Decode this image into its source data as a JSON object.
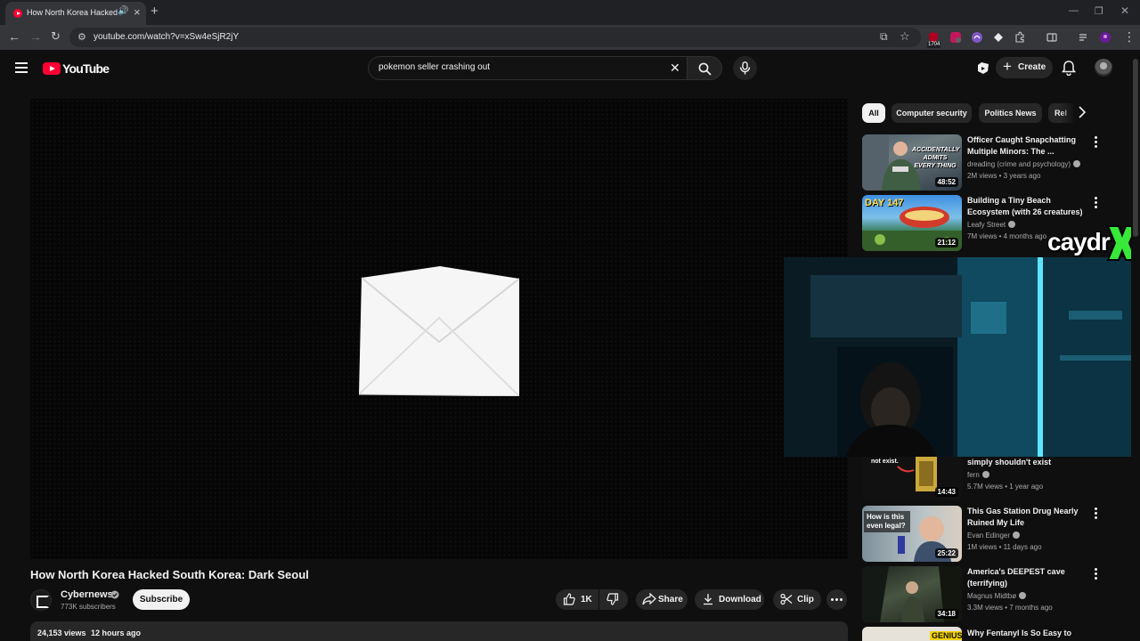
{
  "browser": {
    "tab_title": "How North Korea Hacked South Korea: Dark Seoul",
    "url": "youtube.com/watch?v=xSw4eSjR2jY",
    "extension_badge": "1704"
  },
  "header": {
    "logo_text": "YouTube",
    "search_value": "pokemon seller crashing out",
    "create_label": "Create"
  },
  "video": {
    "title": "How North Korea Hacked South Korea: Dark Seoul",
    "channel_name": "Cybernews",
    "subscribers": "773K subscribers",
    "subscribe_label": "Subscribe",
    "likes": "1K",
    "share_label": "Share",
    "download_label": "Download",
    "clip_label": "Clip",
    "views": "24,153 views",
    "age": "12 hours ago"
  },
  "chips": [
    "All",
    "Computer security",
    "Politics News",
    "Rel"
  ],
  "recommendations": [
    {
      "title": "Officer Caught Snapchatting Multiple Minors: The ...",
      "channel": "dreading (crime and psychology)",
      "meta": "2M views • 3 years ago",
      "duration": "48:52",
      "thumb_text": "ACCIDENTALLY ADMITS EVERY THING"
    },
    {
      "title": "Building a Tiny Beach Ecosystem (with 26 creatures)",
      "channel": "Leafy Street",
      "meta": "7M views • 4 months ago",
      "duration": "21:12",
      "thumb_text": "DAY 147"
    },
    {
      "title": "simply shouldn't exist",
      "channel": "fern",
      "meta": "5.7M views • 1 year ago",
      "duration": "14:43",
      "thumb_text": "not exist."
    },
    {
      "title": "This Gas Station Drug Nearly Ruined My Life",
      "channel": "Evan Edinger",
      "meta": "1M views • 11 days ago",
      "duration": "25:22",
      "thumb_text": "How is this even legal?"
    },
    {
      "title": "America's DEEPEST cave (terrifying)",
      "channel": "Magnus Midtbø",
      "meta": "3.3M views • 7 months ago",
      "duration": "34:18",
      "thumb_text": ""
    },
    {
      "title": "Why Fentanyl Is So Easy to",
      "channel": "",
      "meta": "",
      "duration": "",
      "thumb_text": "GENIUS"
    }
  ],
  "overlay": {
    "streamer_name": "caydr"
  },
  "colors": {
    "background": "#0f0f0f",
    "youtube_red": "#ff0033",
    "chip_bg": "#272727",
    "webcam_cyan": "#15a6c8",
    "logo_green": "#37e83a"
  }
}
